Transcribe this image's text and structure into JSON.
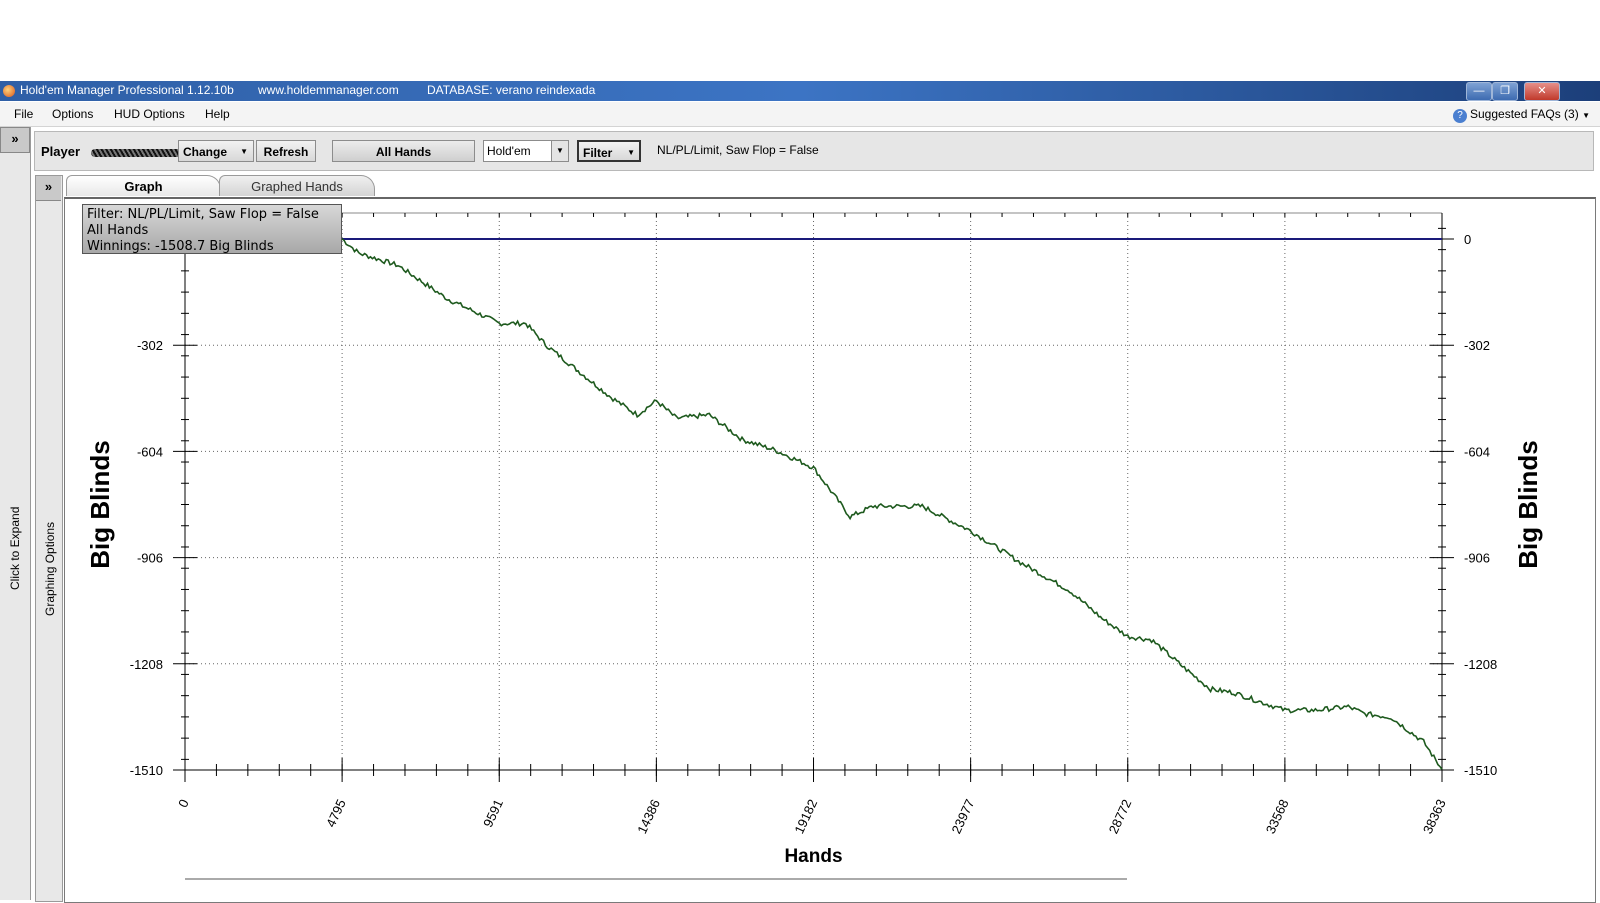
{
  "window": {
    "title": "Hold'em Manager Professional 1.12.10b",
    "website": "www.holdemmanager.com",
    "database": "DATABASE: verano reindexada"
  },
  "menu": {
    "items": [
      "File",
      "Options",
      "HUD Options",
      "Help"
    ],
    "faq": "Suggested FAQs (3)"
  },
  "side": {
    "expand_label": "Click to Expand",
    "graph_options_label": "Graphing Options"
  },
  "toolbar": {
    "player_label": "Player",
    "change_label": "Change",
    "refresh_label": "Refresh",
    "all_hands_label": "All Hands",
    "game_value": "Hold'em",
    "filter_label": "Filter",
    "filter_text": "NL/PL/Limit, Saw Flop = False"
  },
  "tabs": [
    "Graph",
    "Graphed Hands"
  ],
  "info": {
    "filter_line": "Filter: NL/PL/Limit, Saw Flop = False",
    "hands_line": "All Hands",
    "winnings_line": "Winnings: -1508.7 Big Blinds"
  },
  "chart_data": {
    "type": "line",
    "xlabel": "Hands",
    "ylabel": "Big Blinds",
    "xlim": [
      0,
      38363
    ],
    "ylim": [
      -1510,
      0
    ],
    "x_ticks": [
      0,
      4795,
      9591,
      14386,
      19182,
      23977,
      28772,
      33568,
      38363
    ],
    "y_ticks": [
      0,
      -302,
      -604,
      -906,
      -1208,
      -1510
    ],
    "grid": true,
    "colors": {
      "line": "#1e5a1e",
      "zero_line": "#1a1a7a"
    },
    "series": [
      {
        "x": [
          0,
          4795,
          5300,
          6500,
          8000,
          9591,
          10400,
          11000,
          12000,
          13000,
          13800,
          14386,
          15000,
          16000,
          17000,
          18000,
          19182,
          20300,
          21000,
          22500,
          23977,
          25500,
          27000,
          28000,
          28772,
          29500,
          30500,
          31300,
          32000,
          33568,
          34500,
          35500,
          36000,
          36800,
          37800,
          38363
        ],
        "y": [
          0,
          0,
          -40,
          -75,
          -170,
          -240,
          -240,
          -300,
          -375,
          -450,
          -500,
          -460,
          -510,
          -500,
          -570,
          -600,
          -650,
          -790,
          -760,
          -760,
          -830,
          -920,
          -1000,
          -1080,
          -1130,
          -1140,
          -1220,
          -1280,
          -1290,
          -1340,
          -1340,
          -1330,
          -1350,
          -1360,
          -1430,
          -1508.7
        ]
      }
    ]
  }
}
